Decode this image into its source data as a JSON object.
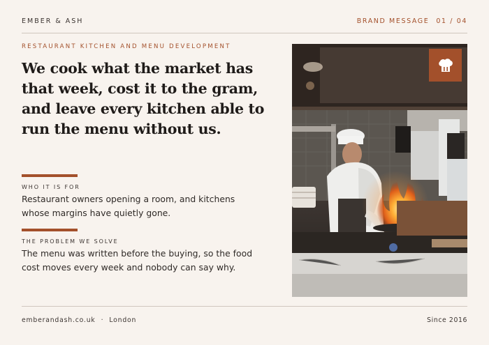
{
  "header": {
    "brand": "EMBER & ASH",
    "section_label": "BRAND MESSAGE",
    "page_indicator": "01 / 04"
  },
  "main": {
    "eyebrow": "RESTAURANT KITCHEN AND MENU DEVELOPMENT",
    "headline": "We cook what the market has that week, cost it to the gram, and leave every kitchen able to run the menu without us.",
    "sections": [
      {
        "label": "WHO IT IS FOR",
        "body": "Restaurant owners opening a room, and kitchens whose margins have quietly gone."
      },
      {
        "label": "THE PROBLEM WE SOLVE",
        "body": "The menu was written before the buying, so the food cost moves every week and nobody can say why."
      }
    ]
  },
  "photo": {
    "badge_icon": "chef-hat-icon"
  },
  "footer": {
    "website": "emberandash.co.uk",
    "separator": "·",
    "city": "London",
    "since": "Since 2016"
  },
  "colors": {
    "accent": "#a3502b",
    "background": "#f8f3ee",
    "text": "#1f1b19"
  }
}
